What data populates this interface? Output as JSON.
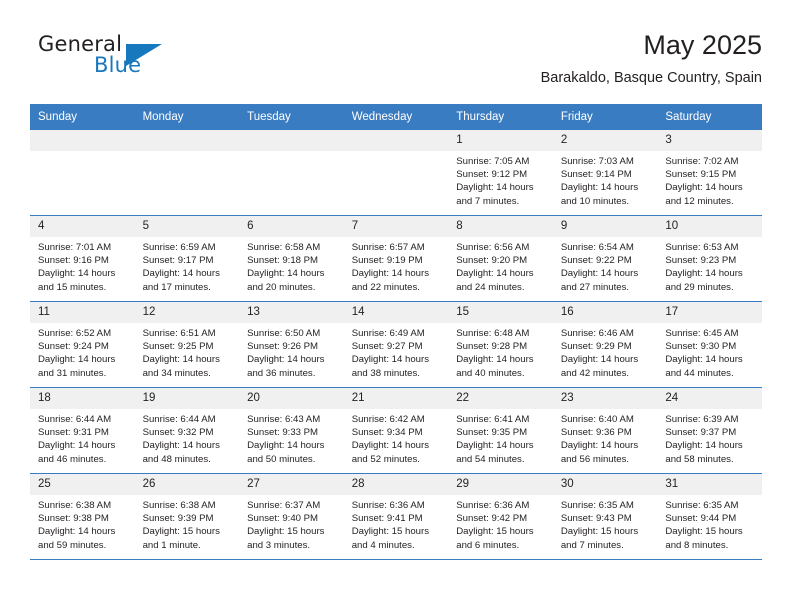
{
  "brand": {
    "name_part1": "General",
    "name_part2": "Blue",
    "accent_color": "#1878be"
  },
  "header": {
    "title": "May 2025",
    "subtitle": "Barakaldo, Basque Country, Spain"
  },
  "theme": {
    "header_bar_color": "#3a7cc1",
    "daynum_band_color": "#f0f0f0",
    "text_color": "#231f20"
  },
  "weekday_headers": [
    "Sunday",
    "Monday",
    "Tuesday",
    "Wednesday",
    "Thursday",
    "Friday",
    "Saturday"
  ],
  "weeks": [
    [
      {
        "day": "",
        "empty": true,
        "sunrise": "",
        "sunset": "",
        "daylight1": "",
        "daylight2": ""
      },
      {
        "day": "",
        "empty": true,
        "sunrise": "",
        "sunset": "",
        "daylight1": "",
        "daylight2": ""
      },
      {
        "day": "",
        "empty": true,
        "sunrise": "",
        "sunset": "",
        "daylight1": "",
        "daylight2": ""
      },
      {
        "day": "",
        "empty": true,
        "sunrise": "",
        "sunset": "",
        "daylight1": "",
        "daylight2": ""
      },
      {
        "day": "1",
        "empty": false,
        "sunrise": "Sunrise: 7:05 AM",
        "sunset": "Sunset: 9:12 PM",
        "daylight1": "Daylight: 14 hours",
        "daylight2": "and 7 minutes."
      },
      {
        "day": "2",
        "empty": false,
        "sunrise": "Sunrise: 7:03 AM",
        "sunset": "Sunset: 9:14 PM",
        "daylight1": "Daylight: 14 hours",
        "daylight2": "and 10 minutes."
      },
      {
        "day": "3",
        "empty": false,
        "sunrise": "Sunrise: 7:02 AM",
        "sunset": "Sunset: 9:15 PM",
        "daylight1": "Daylight: 14 hours",
        "daylight2": "and 12 minutes."
      }
    ],
    [
      {
        "day": "4",
        "empty": false,
        "sunrise": "Sunrise: 7:01 AM",
        "sunset": "Sunset: 9:16 PM",
        "daylight1": "Daylight: 14 hours",
        "daylight2": "and 15 minutes."
      },
      {
        "day": "5",
        "empty": false,
        "sunrise": "Sunrise: 6:59 AM",
        "sunset": "Sunset: 9:17 PM",
        "daylight1": "Daylight: 14 hours",
        "daylight2": "and 17 minutes."
      },
      {
        "day": "6",
        "empty": false,
        "sunrise": "Sunrise: 6:58 AM",
        "sunset": "Sunset: 9:18 PM",
        "daylight1": "Daylight: 14 hours",
        "daylight2": "and 20 minutes."
      },
      {
        "day": "7",
        "empty": false,
        "sunrise": "Sunrise: 6:57 AM",
        "sunset": "Sunset: 9:19 PM",
        "daylight1": "Daylight: 14 hours",
        "daylight2": "and 22 minutes."
      },
      {
        "day": "8",
        "empty": false,
        "sunrise": "Sunrise: 6:56 AM",
        "sunset": "Sunset: 9:20 PM",
        "daylight1": "Daylight: 14 hours",
        "daylight2": "and 24 minutes."
      },
      {
        "day": "9",
        "empty": false,
        "sunrise": "Sunrise: 6:54 AM",
        "sunset": "Sunset: 9:22 PM",
        "daylight1": "Daylight: 14 hours",
        "daylight2": "and 27 minutes."
      },
      {
        "day": "10",
        "empty": false,
        "sunrise": "Sunrise: 6:53 AM",
        "sunset": "Sunset: 9:23 PM",
        "daylight1": "Daylight: 14 hours",
        "daylight2": "and 29 minutes."
      }
    ],
    [
      {
        "day": "11",
        "empty": false,
        "sunrise": "Sunrise: 6:52 AM",
        "sunset": "Sunset: 9:24 PM",
        "daylight1": "Daylight: 14 hours",
        "daylight2": "and 31 minutes."
      },
      {
        "day": "12",
        "empty": false,
        "sunrise": "Sunrise: 6:51 AM",
        "sunset": "Sunset: 9:25 PM",
        "daylight1": "Daylight: 14 hours",
        "daylight2": "and 34 minutes."
      },
      {
        "day": "13",
        "empty": false,
        "sunrise": "Sunrise: 6:50 AM",
        "sunset": "Sunset: 9:26 PM",
        "daylight1": "Daylight: 14 hours",
        "daylight2": "and 36 minutes."
      },
      {
        "day": "14",
        "empty": false,
        "sunrise": "Sunrise: 6:49 AM",
        "sunset": "Sunset: 9:27 PM",
        "daylight1": "Daylight: 14 hours",
        "daylight2": "and 38 minutes."
      },
      {
        "day": "15",
        "empty": false,
        "sunrise": "Sunrise: 6:48 AM",
        "sunset": "Sunset: 9:28 PM",
        "daylight1": "Daylight: 14 hours",
        "daylight2": "and 40 minutes."
      },
      {
        "day": "16",
        "empty": false,
        "sunrise": "Sunrise: 6:46 AM",
        "sunset": "Sunset: 9:29 PM",
        "daylight1": "Daylight: 14 hours",
        "daylight2": "and 42 minutes."
      },
      {
        "day": "17",
        "empty": false,
        "sunrise": "Sunrise: 6:45 AM",
        "sunset": "Sunset: 9:30 PM",
        "daylight1": "Daylight: 14 hours",
        "daylight2": "and 44 minutes."
      }
    ],
    [
      {
        "day": "18",
        "empty": false,
        "sunrise": "Sunrise: 6:44 AM",
        "sunset": "Sunset: 9:31 PM",
        "daylight1": "Daylight: 14 hours",
        "daylight2": "and 46 minutes."
      },
      {
        "day": "19",
        "empty": false,
        "sunrise": "Sunrise: 6:44 AM",
        "sunset": "Sunset: 9:32 PM",
        "daylight1": "Daylight: 14 hours",
        "daylight2": "and 48 minutes."
      },
      {
        "day": "20",
        "empty": false,
        "sunrise": "Sunrise: 6:43 AM",
        "sunset": "Sunset: 9:33 PM",
        "daylight1": "Daylight: 14 hours",
        "daylight2": "and 50 minutes."
      },
      {
        "day": "21",
        "empty": false,
        "sunrise": "Sunrise: 6:42 AM",
        "sunset": "Sunset: 9:34 PM",
        "daylight1": "Daylight: 14 hours",
        "daylight2": "and 52 minutes."
      },
      {
        "day": "22",
        "empty": false,
        "sunrise": "Sunrise: 6:41 AM",
        "sunset": "Sunset: 9:35 PM",
        "daylight1": "Daylight: 14 hours",
        "daylight2": "and 54 minutes."
      },
      {
        "day": "23",
        "empty": false,
        "sunrise": "Sunrise: 6:40 AM",
        "sunset": "Sunset: 9:36 PM",
        "daylight1": "Daylight: 14 hours",
        "daylight2": "and 56 minutes."
      },
      {
        "day": "24",
        "empty": false,
        "sunrise": "Sunrise: 6:39 AM",
        "sunset": "Sunset: 9:37 PM",
        "daylight1": "Daylight: 14 hours",
        "daylight2": "and 58 minutes."
      }
    ],
    [
      {
        "day": "25",
        "empty": false,
        "sunrise": "Sunrise: 6:38 AM",
        "sunset": "Sunset: 9:38 PM",
        "daylight1": "Daylight: 14 hours",
        "daylight2": "and 59 minutes."
      },
      {
        "day": "26",
        "empty": false,
        "sunrise": "Sunrise: 6:38 AM",
        "sunset": "Sunset: 9:39 PM",
        "daylight1": "Daylight: 15 hours",
        "daylight2": "and 1 minute."
      },
      {
        "day": "27",
        "empty": false,
        "sunrise": "Sunrise: 6:37 AM",
        "sunset": "Sunset: 9:40 PM",
        "daylight1": "Daylight: 15 hours",
        "daylight2": "and 3 minutes."
      },
      {
        "day": "28",
        "empty": false,
        "sunrise": "Sunrise: 6:36 AM",
        "sunset": "Sunset: 9:41 PM",
        "daylight1": "Daylight: 15 hours",
        "daylight2": "and 4 minutes."
      },
      {
        "day": "29",
        "empty": false,
        "sunrise": "Sunrise: 6:36 AM",
        "sunset": "Sunset: 9:42 PM",
        "daylight1": "Daylight: 15 hours",
        "daylight2": "and 6 minutes."
      },
      {
        "day": "30",
        "empty": false,
        "sunrise": "Sunrise: 6:35 AM",
        "sunset": "Sunset: 9:43 PM",
        "daylight1": "Daylight: 15 hours",
        "daylight2": "and 7 minutes."
      },
      {
        "day": "31",
        "empty": false,
        "sunrise": "Sunrise: 6:35 AM",
        "sunset": "Sunset: 9:44 PM",
        "daylight1": "Daylight: 15 hours",
        "daylight2": "and 8 minutes."
      }
    ]
  ]
}
